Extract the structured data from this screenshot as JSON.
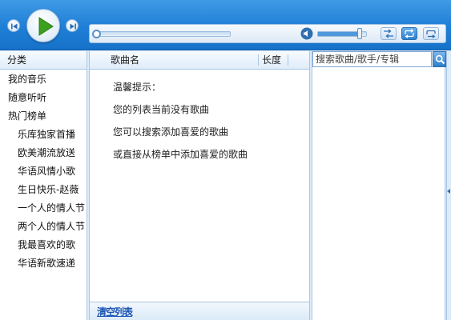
{
  "player": {
    "progress": 0.0,
    "volume": 0.85
  },
  "sidebar": {
    "header": "分类",
    "items": [
      {
        "label": "我的音乐",
        "level": 0
      },
      {
        "label": "随意听听",
        "level": 0
      },
      {
        "label": "热门榜单",
        "level": 0
      },
      {
        "label": "乐库独家首播",
        "level": 1
      },
      {
        "label": "欧美潮流放送",
        "level": 1
      },
      {
        "label": "华语风情小歌",
        "level": 1
      },
      {
        "label": "生日快乐-赵薇",
        "level": 1
      },
      {
        "label": "一个人的情人节",
        "level": 1
      },
      {
        "label": "两个人的情人节",
        "level": 1
      },
      {
        "label": "我最喜欢的歌",
        "level": 1
      },
      {
        "label": "华语新歌速递",
        "level": 1
      }
    ]
  },
  "playlist": {
    "col_title": "歌曲名",
    "col_length": "长度",
    "hints": [
      "温馨提示：",
      "您的列表当前没有歌曲",
      "您可以搜索添加喜爱的歌曲",
      "或直接从榜单中添加喜爱的歌曲"
    ],
    "footer_link": "清空列表"
  },
  "search": {
    "placeholder": "搜索歌曲/歌手/专辑"
  },
  "colors": {
    "accent": "#1f7fd6",
    "panel_border": "#a8c6e5",
    "link": "#1a55b3"
  }
}
